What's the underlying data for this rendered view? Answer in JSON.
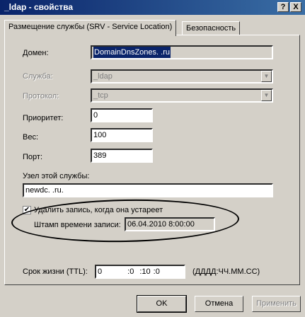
{
  "window": {
    "title": "_ldap - свойства",
    "help_btn": "?",
    "close_btn": "X"
  },
  "tabs": [
    {
      "label": "Размещение службы (SRV - Service Location)"
    },
    {
      "label": "Безопасность"
    }
  ],
  "form": {
    "domain": {
      "label": "Домен:",
      "value": "DomainDnsZones.     .ru"
    },
    "service": {
      "label": "Служба:",
      "value": "_ldap"
    },
    "protocol": {
      "label": "Протокол:",
      "value": "_tcp"
    },
    "priority": {
      "label": "Приоритет:",
      "value": "0"
    },
    "weight": {
      "label": "Вес:",
      "value": "100"
    },
    "port": {
      "label": "Порт:",
      "value": "389"
    },
    "host": {
      "label": "Узел этой службы:",
      "value": "newdc.     .ru."
    },
    "delete_stale": {
      "label": "Удалить запись, когда она устареет",
      "checked": true
    },
    "timestamp": {
      "label": "Штамп времени записи:",
      "value": "06.04.2010 8:00:00"
    },
    "ttl": {
      "label": "Срок жизни (TTL):",
      "days": "0",
      "hours": "0",
      "minutes": "10",
      "seconds": "0",
      "format": "(ДДДД:ЧЧ.ММ.СС)"
    }
  },
  "buttons": {
    "ok": "OK",
    "cancel": "Отмена",
    "apply": "Применить"
  }
}
